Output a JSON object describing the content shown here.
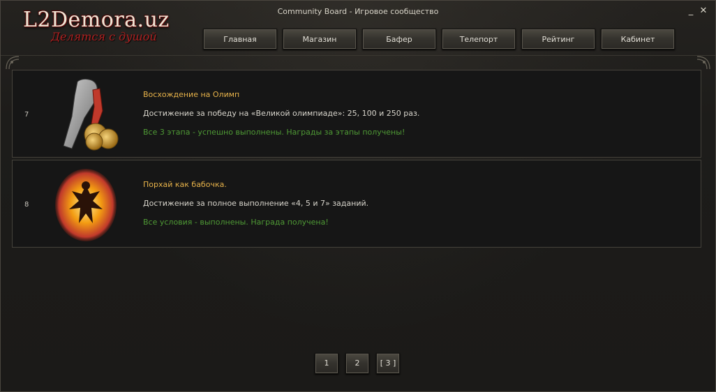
{
  "window": {
    "title": "Community Board - Игровое сообщество",
    "minimize_glyph": "_",
    "close_glyph": "✕"
  },
  "logo": {
    "main": "L2Demora.uz",
    "sub": "Делятся с душой"
  },
  "nav": {
    "items": [
      {
        "label": "Главная"
      },
      {
        "label": "Магазин"
      },
      {
        "label": "Бафер"
      },
      {
        "label": "Телепорт"
      },
      {
        "label": "Рейтинг"
      },
      {
        "label": "Кабинет"
      }
    ]
  },
  "achievements": [
    {
      "number": "7",
      "icon": "fist-with-medals-icon",
      "title": "Восхождение на Олимп",
      "description": "Достижение за победу на «Великой олимпиаде»: 25, 100 и 250 раз.",
      "status": "Все 3 этапа - успешно выполнены. Награды за этапы получены!"
    },
    {
      "number": "8",
      "icon": "burning-figure-icon",
      "title": "Порхай как бабочка.",
      "description": "Достижение за полное выполнение «4, 5 и 7» заданий.",
      "status": "Все условия - выполнены. Награда получена!"
    }
  ],
  "pagination": {
    "pages": [
      {
        "label": "1"
      },
      {
        "label": "2"
      },
      {
        "label": "[ 3 ]"
      }
    ],
    "current": 3
  },
  "colors": {
    "title": "#e8b34a",
    "status": "#4f9a35",
    "text": "#d9d6cd"
  }
}
